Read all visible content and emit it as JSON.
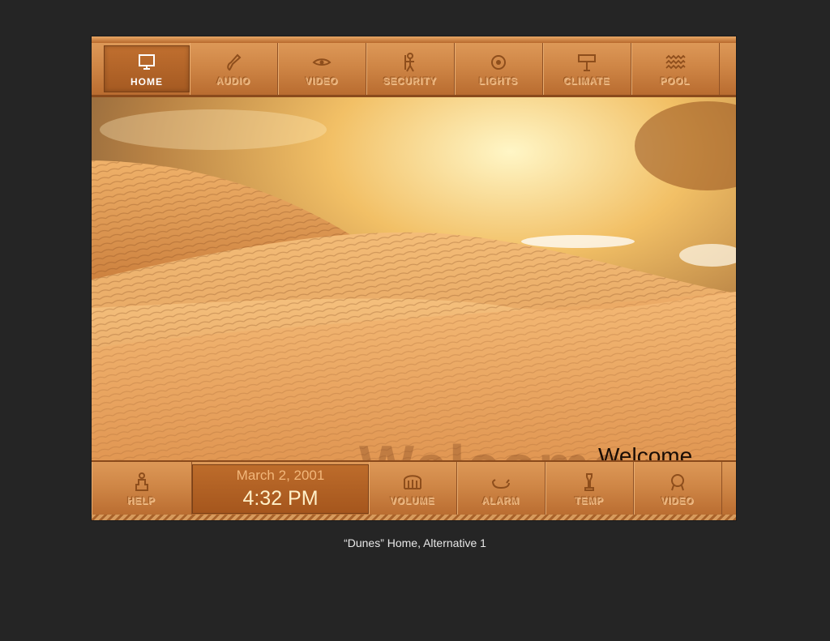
{
  "top_nav": [
    {
      "label": "HOME",
      "icon": "screen-icon"
    },
    {
      "label": "AUDIO",
      "icon": "guitar-icon"
    },
    {
      "label": "VIDEO",
      "icon": "eye-icon"
    },
    {
      "label": "SECURITY",
      "icon": "guard-figure-icon"
    },
    {
      "label": "LIGHTS",
      "icon": "sun-disk-icon"
    },
    {
      "label": "CLIMATE",
      "icon": "sign-icon"
    },
    {
      "label": "POOL",
      "icon": "water-waves-icon"
    }
  ],
  "bottom_nav": {
    "help": {
      "label": "HELP",
      "icon": "seated-figure-icon"
    },
    "date": "March 2, 2001",
    "time": "4:32 PM",
    "volume": {
      "label": "VOLUME",
      "icon": "harp-icon"
    },
    "alarm": {
      "label": "ALARM",
      "icon": "bird-icon"
    },
    "temp": {
      "label": "TEMP",
      "icon": "vessel-icon"
    },
    "video": {
      "label": "VIDEO",
      "icon": "head-icon"
    }
  },
  "welcome": "Welcome",
  "caption": "“Dunes” Home, Alternative 1",
  "colors": {
    "bar": "#cf8646",
    "active": "#a55a22",
    "background": "#252525"
  }
}
